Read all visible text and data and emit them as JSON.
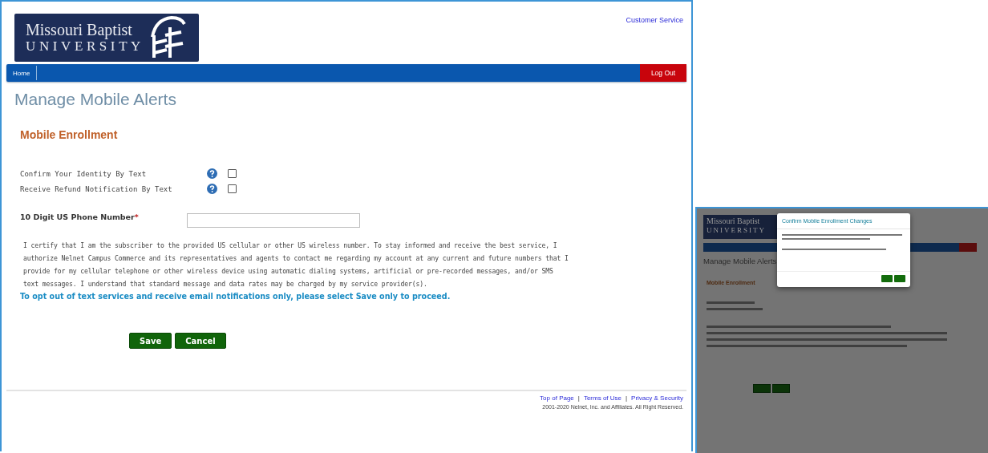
{
  "logo": {
    "line1": "Missouri Baptist",
    "line2": "UNIVERSITY"
  },
  "header_link": "Customer Service",
  "nav": {
    "items": [
      "Home"
    ],
    "logout": "Log Out"
  },
  "page_title": "Manage Mobile Alerts",
  "section_title": "Mobile Enrollment",
  "options": [
    {
      "label": "Confirm Your Identity By Text",
      "checked": false
    },
    {
      "label": "Receive Refund Notification By Text",
      "checked": false
    }
  ],
  "phone": {
    "label": "10 Digit US Phone Number",
    "required_mark": "*"
  },
  "consent": "I certify that I am the subscriber to the provided US cellular or other US wireless number. To stay informed and receive the best service, I authorize Nelnet Campus Commerce and its representatives and agents to contact me regarding my account at any current and future numbers that I provide for my cellular telephone or other wireless device using automatic dialing systems, artificial or pre-recorded messages, and/or SMS text messages. I understand that standard message and data rates may be charged by my service provider(s).",
  "opt_out_note": "To opt out of text services and receive email notifications only, please select Save only to proceed.",
  "buttons": [
    "Save",
    "Cancel"
  ],
  "footer": {
    "links": [
      "Top of Page",
      "Terms of Use",
      "Privacy & Security"
    ],
    "separator": "|",
    "copyright": "2001-2020 Nelnet, Inc. and Affiliates. All Right Reserved."
  },
  "inset": {
    "logo": {
      "line1": "Missouri Baptist",
      "line2": "UNIVERSITY"
    },
    "page_title": "Manage Mobile Alerts",
    "section_title": "Mobile Enrollment",
    "dialog": {
      "title": "Confirm Mobile Enrollment Changes"
    }
  }
}
